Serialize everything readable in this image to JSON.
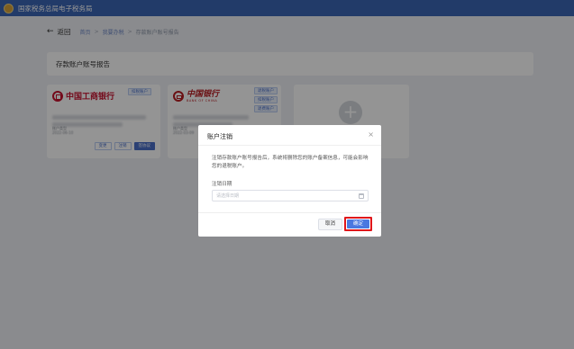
{
  "header": {
    "title": "国家税务总局电子税务局",
    "logo_icon": "tax-emblem-icon"
  },
  "breadcrumb": {
    "back_label": "返回",
    "items": [
      "首页",
      "我要办税",
      "存款账户账号报告"
    ]
  },
  "panel": {
    "title": "存款账户账号报告"
  },
  "cards": [
    {
      "bank_name": "中国工商银行",
      "tags": [
        "扣税账户"
      ],
      "meta_label": "账户类型",
      "meta_date": "2022-06-10",
      "actions": [
        "变更",
        "注销",
        "签协议"
      ]
    },
    {
      "bank_name": "中国银行",
      "bank_name_en": "BANK OF CHINA",
      "tags": [
        "退税账户",
        "扣税账户",
        "退费账户"
      ],
      "meta_label": "账户类型",
      "meta_date": "2022-03-09"
    }
  ],
  "add_card": {
    "icon": "plus-icon"
  },
  "dialog": {
    "title": "账户注销",
    "message": "注销存款账户账号报告后，系统将删除您的账户备案信息，可能会影响您的退税账户。",
    "date_label": "注销日期",
    "date_placeholder": "请选择日期",
    "cancel_label": "取消",
    "confirm_label": "确定",
    "close_icon": "close-icon"
  },
  "colors": {
    "header": "#3b66b6",
    "primary": "#4a78e0",
    "highlight": "#e0151a",
    "icbc": "#c8102e",
    "boc": "#b81c22"
  }
}
